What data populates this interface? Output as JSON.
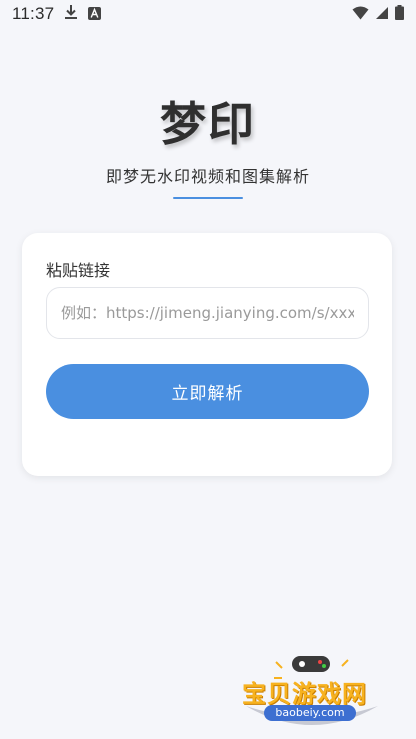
{
  "status_bar": {
    "time": "11:37",
    "icons": [
      "download-icon",
      "a-badge-icon",
      "wifi-icon",
      "signal-icon",
      "battery-icon"
    ]
  },
  "header": {
    "title": "梦印",
    "subtitle": "即梦无水印视频和图集解析"
  },
  "form": {
    "label": "粘贴链接",
    "input_value": "",
    "input_placeholder": "例如：https://jimeng.jianying.com/s/xxx",
    "button_label": "立即解析"
  },
  "watermark": {
    "text": "宝贝游戏网",
    "url": "baobeiy.com"
  },
  "colors": {
    "accent": "#4a8fe0",
    "background": "#f5f6fa",
    "card": "#ffffff",
    "watermark_orange": "#f7b21f",
    "watermark_blue": "#3d6fd1"
  }
}
